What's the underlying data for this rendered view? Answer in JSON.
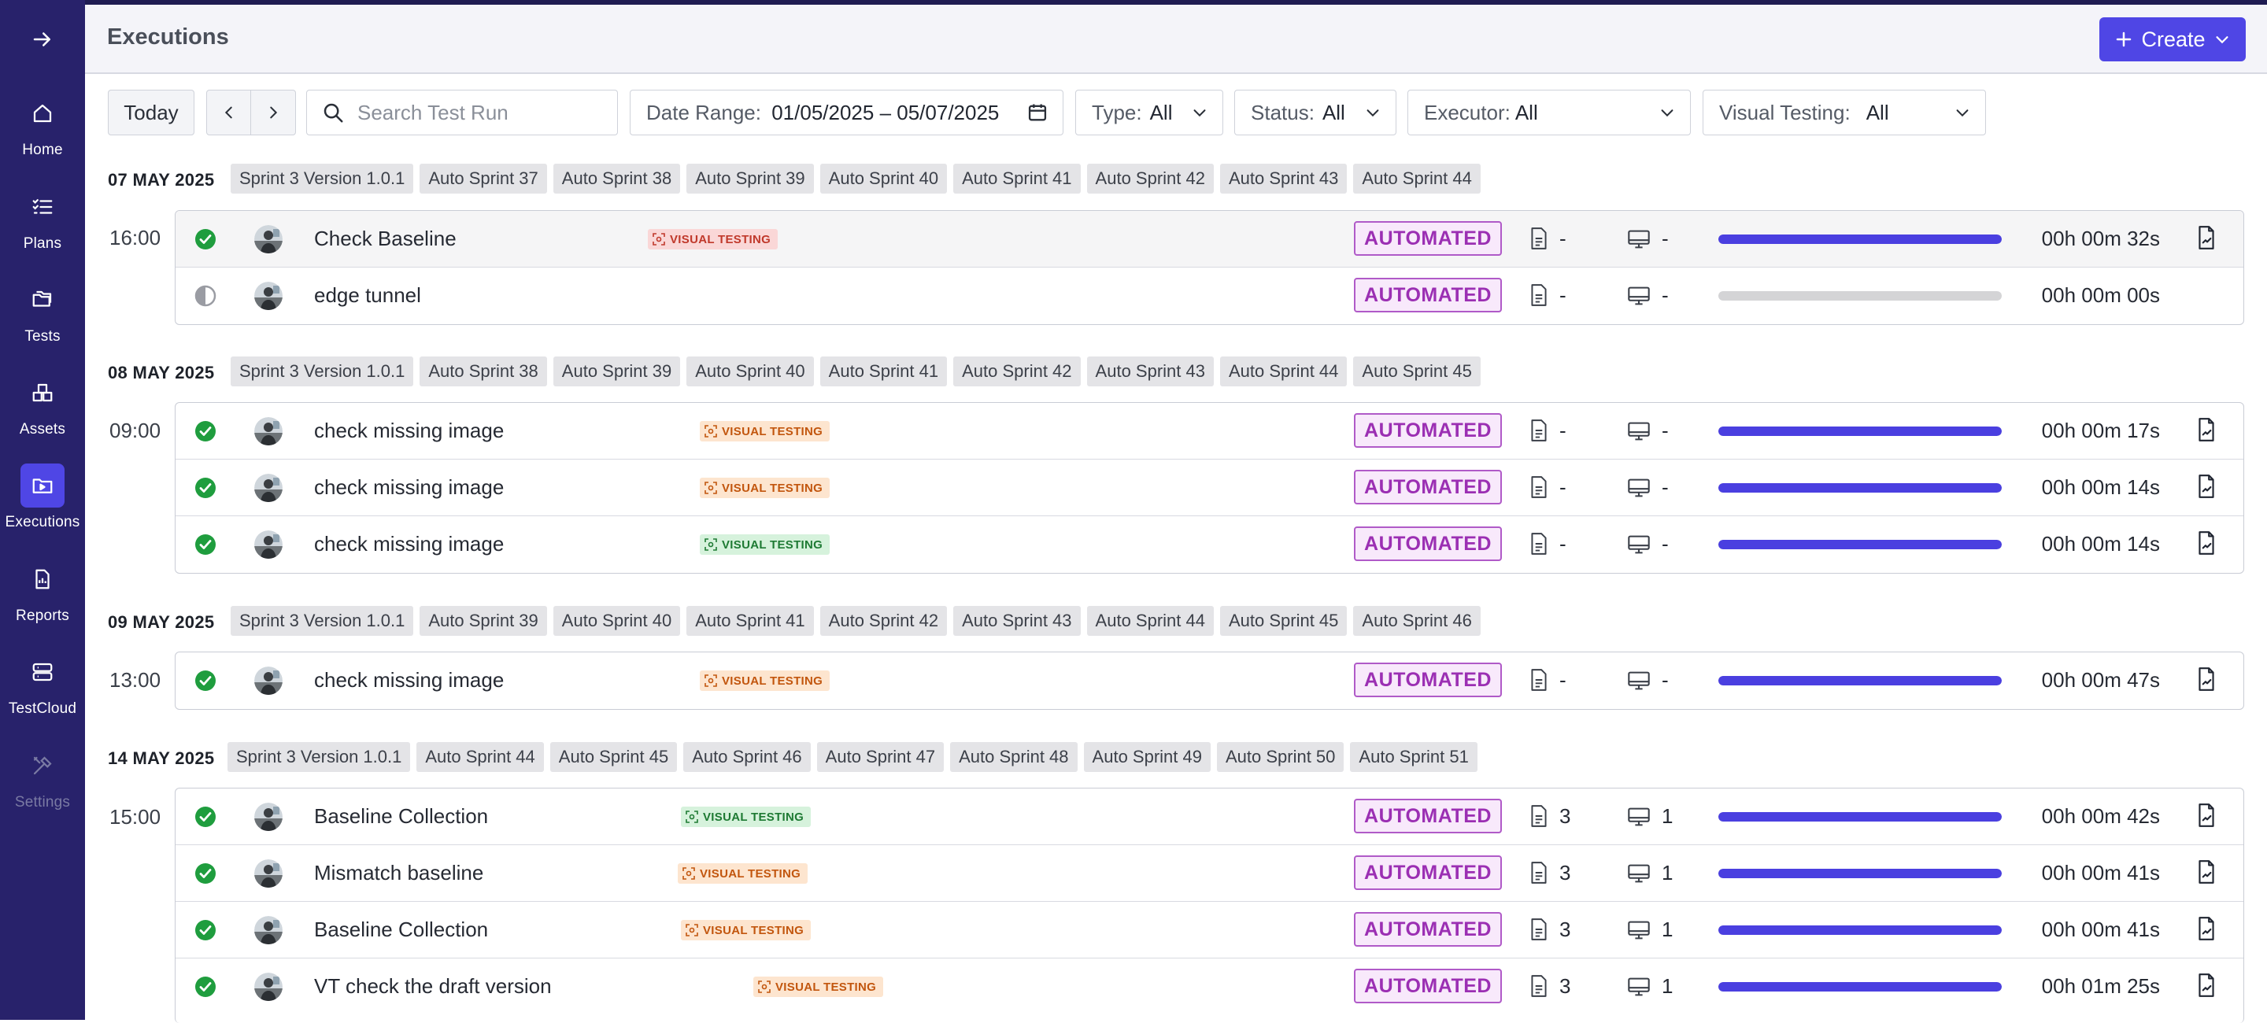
{
  "app": {
    "accent": "#4f46e5",
    "sidebar_bg": "#28226b"
  },
  "sidebar": {
    "toggle_icon": "arrow-right-icon",
    "items": [
      {
        "label": "Home",
        "icon": "home-icon"
      },
      {
        "label": "Plans",
        "icon": "list-checks-icon"
      },
      {
        "label": "Tests",
        "icon": "folder-icon"
      },
      {
        "label": "Assets",
        "icon": "assets-icon"
      },
      {
        "label": "Executions",
        "icon": "folder-play-icon",
        "active": true
      },
      {
        "label": "Reports",
        "icon": "report-icon"
      },
      {
        "label": "TestCloud",
        "icon": "server-icon"
      },
      {
        "label": "Settings",
        "icon": "tools-icon",
        "disabled": true
      }
    ]
  },
  "header": {
    "title": "Executions",
    "create_label": "Create"
  },
  "toolbar": {
    "today_label": "Today",
    "search_placeholder": "Search Test Run",
    "date_range_label": "Date Range:",
    "date_range_value": "01/05/2025 – 05/07/2025",
    "type_label": "Type:",
    "type_value": "All",
    "status_label": "Status:",
    "status_value": "All",
    "executor_label": "Executor:",
    "executor_value": "All",
    "visual_label": "Visual Testing:",
    "visual_value": "All"
  },
  "groups": [
    {
      "date": "07 MAY 2025",
      "tags": [
        "Sprint 3 Version 1.0.1",
        "Auto Sprint 37",
        "Auto Sprint 38",
        "Auto Sprint 39",
        "Auto Sprint 40",
        "Auto Sprint 41",
        "Auto Sprint 42",
        "Auto Sprint 43",
        "Auto Sprint 44"
      ],
      "time": "16:00",
      "runs": [
        {
          "name": "Check Baseline",
          "status": "passed",
          "vt": "VISUAL TESTING",
          "vt_color": "red",
          "type": "AUTOMATED",
          "docs": "-",
          "machines": "-",
          "progress": 1.0,
          "duration": "00h 00m 32s",
          "report": true,
          "highlight": true
        },
        {
          "name": "edge tunnel",
          "status": "incomplete",
          "vt": "",
          "vt_color": "",
          "type": "AUTOMATED",
          "docs": "-",
          "machines": "-",
          "progress": 0.0,
          "duration": "00h 00m 00s",
          "report": false
        }
      ]
    },
    {
      "date": "08 MAY 2025",
      "tags": [
        "Sprint 3 Version 1.0.1",
        "Auto Sprint 38",
        "Auto Sprint 39",
        "Auto Sprint 40",
        "Auto Sprint 41",
        "Auto Sprint 42",
        "Auto Sprint 43",
        "Auto Sprint 44",
        "Auto Sprint 45"
      ],
      "time": "09:00",
      "runs": [
        {
          "name": "check missing image",
          "status": "passed",
          "vt": "VISUAL TESTING",
          "vt_color": "orange",
          "type": "AUTOMATED",
          "docs": "-",
          "machines": "-",
          "progress": 1.0,
          "duration": "00h 00m 17s",
          "report": true
        },
        {
          "name": "check missing image",
          "status": "passed",
          "vt": "VISUAL TESTING",
          "vt_color": "orange",
          "type": "AUTOMATED",
          "docs": "-",
          "machines": "-",
          "progress": 1.0,
          "duration": "00h 00m 14s",
          "report": true
        },
        {
          "name": "check missing image",
          "status": "passed",
          "vt": "VISUAL TESTING",
          "vt_color": "green",
          "type": "AUTOMATED",
          "docs": "-",
          "machines": "-",
          "progress": 1.0,
          "duration": "00h 00m 14s",
          "report": true
        }
      ]
    },
    {
      "date": "09 MAY 2025",
      "tags": [
        "Sprint 3 Version 1.0.1",
        "Auto Sprint 39",
        "Auto Sprint 40",
        "Auto Sprint 41",
        "Auto Sprint 42",
        "Auto Sprint 43",
        "Auto Sprint 44",
        "Auto Sprint 45",
        "Auto Sprint 46"
      ],
      "time": "13:00",
      "runs": [
        {
          "name": "check missing image",
          "status": "passed",
          "vt": "VISUAL TESTING",
          "vt_color": "orange",
          "type": "AUTOMATED",
          "docs": "-",
          "machines": "-",
          "progress": 1.0,
          "duration": "00h 00m 47s",
          "report": true
        }
      ]
    },
    {
      "date": "14 MAY 2025",
      "tags": [
        "Sprint 3 Version 1.0.1",
        "Auto Sprint 44",
        "Auto Sprint 45",
        "Auto Sprint 46",
        "Auto Sprint 47",
        "Auto Sprint 48",
        "Auto Sprint 49",
        "Auto Sprint 50",
        "Auto Sprint 51"
      ],
      "time": "15:00",
      "runs": [
        {
          "name": "Baseline Collection",
          "status": "passed",
          "vt": "VISUAL TESTING",
          "vt_color": "green",
          "type": "AUTOMATED",
          "docs": "3",
          "machines": "1",
          "progress": 1.0,
          "duration": "00h 00m 42s",
          "report": true
        },
        {
          "name": "Mismatch baseline",
          "status": "passed",
          "vt": "VISUAL TESTING",
          "vt_color": "orange",
          "type": "AUTOMATED",
          "docs": "3",
          "machines": "1",
          "progress": 1.0,
          "duration": "00h 00m 41s",
          "report": true
        },
        {
          "name": "Baseline Collection",
          "status": "passed",
          "vt": "VISUAL TESTING",
          "vt_color": "orange",
          "type": "AUTOMATED",
          "docs": "3",
          "machines": "1",
          "progress": 1.0,
          "duration": "00h 00m 41s",
          "report": true
        },
        {
          "name": "VT check the draft version",
          "status": "passed",
          "vt": "VISUAL TESTING",
          "vt_color": "orange",
          "type": "AUTOMATED",
          "docs": "3",
          "machines": "1",
          "progress": 1.0,
          "duration": "00h 01m 25s",
          "report": true
        }
      ]
    }
  ]
}
